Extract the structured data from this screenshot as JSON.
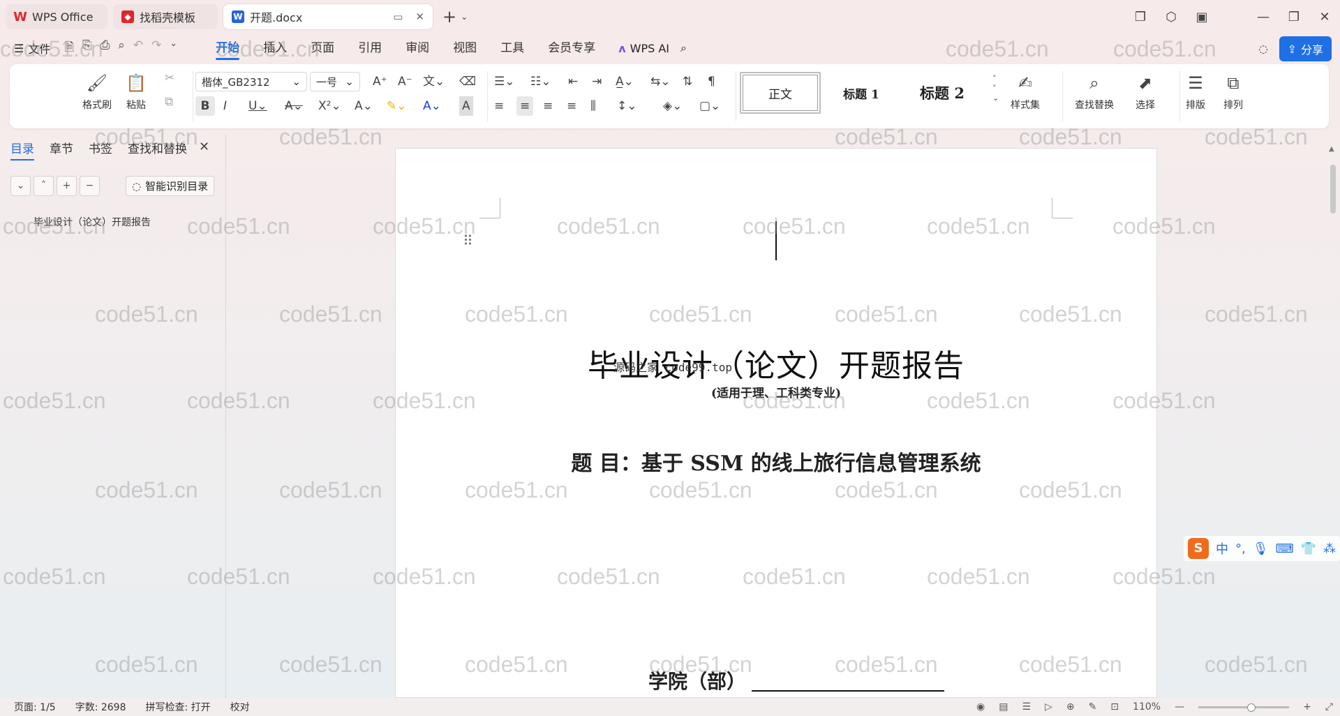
{
  "tabs": [
    {
      "label": "WPS Office",
      "logo": "W",
      "color": "#e0262d"
    },
    {
      "label": "找稻壳模板",
      "logo": "◆",
      "color": "#e0262d"
    },
    {
      "label": "开题.docx",
      "logo": "W",
      "color": "#2a63d8"
    }
  ],
  "menubar": {
    "file_label": "文件",
    "tabs": [
      "开始",
      "插入",
      "页面",
      "引用",
      "审阅",
      "视图",
      "工具",
      "会员专享"
    ],
    "active_tab": "开始",
    "wps_ai": "WPS AI",
    "share": "分享"
  },
  "ribbon": {
    "format_painter": "格式刷",
    "paste": "粘贴",
    "font_name": "楷体_GB2312",
    "font_size": "一号",
    "styles": [
      "正文",
      "标题 1",
      "标题 2"
    ],
    "style_set": "样式集",
    "find_replace": "查找替换",
    "select": "选择",
    "layout": "排版",
    "arrange": "排列"
  },
  "nav": {
    "tabs": [
      "目录",
      "章节",
      "书签",
      "查找和替换"
    ],
    "smart_toc": "智能识别目录",
    "toc_items": [
      "毕业设计（论文）开题报告"
    ]
  },
  "document": {
    "title": "毕业设计（论文）开题报告",
    "subtitle": "(适用于理、工科类专业)",
    "topic": "题  目：基于 SSM 的线上旅行信息管理系统",
    "college": "学院（部）",
    "overlay_note": "源码之家 code99.top"
  },
  "ime": {
    "label": "中"
  },
  "status": {
    "page": "页面: 1/5",
    "words": "字数: 2698",
    "spell": "拼写检查: 打开",
    "proof": "校对",
    "zoom": "110%"
  },
  "watermark": "code51.cn",
  "colors": {
    "accent": "#1f6fe5",
    "wps_red": "#e0262d"
  }
}
